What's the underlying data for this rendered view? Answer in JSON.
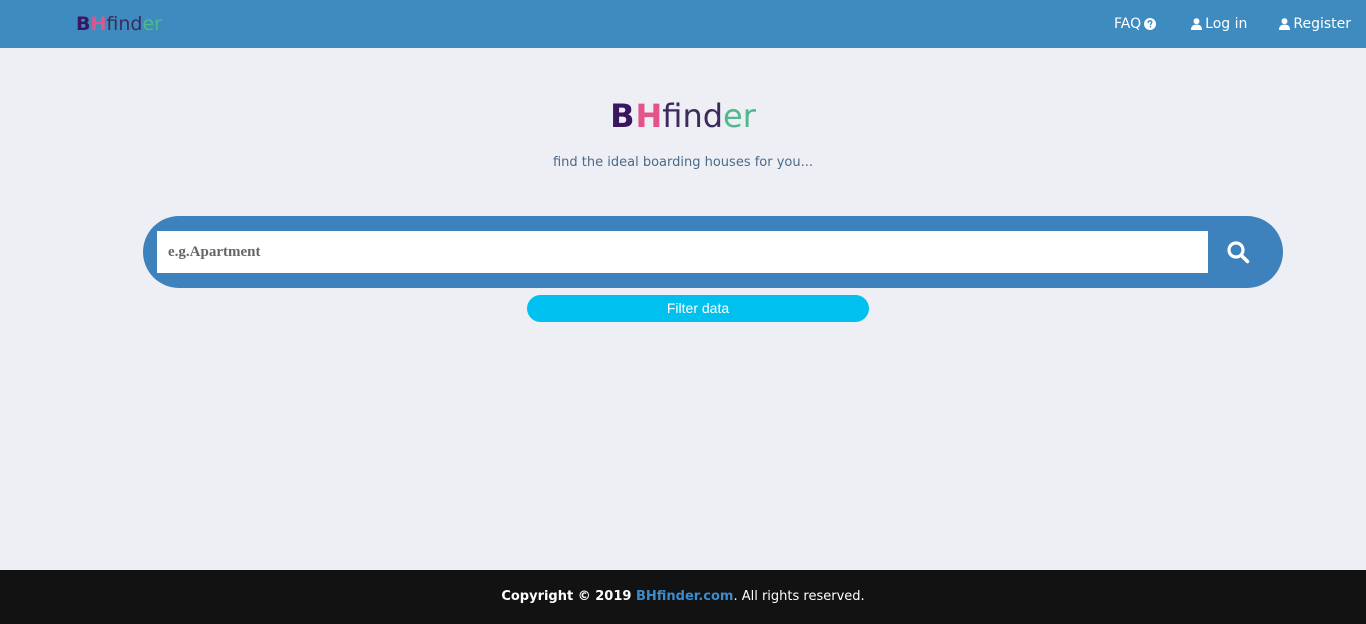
{
  "navbar": {
    "brand": {
      "b": "B",
      "h": "H",
      "fin": "find",
      "er": "er"
    },
    "links": [
      {
        "label": "FAQ",
        "icon": "question-circle-icon"
      },
      {
        "label": "Log in",
        "icon": "user-icon"
      },
      {
        "label": "Register",
        "icon": "user-icon"
      }
    ]
  },
  "hero": {
    "title": {
      "b": "B",
      "h": "H",
      "fin": "find",
      "er": "er"
    },
    "tagline": "find the ideal boarding houses for you..."
  },
  "search": {
    "placeholder": "e.g.Apartment",
    "value": "",
    "button_icon": "search-icon"
  },
  "filter": {
    "label": "Filter data"
  },
  "footer": {
    "prefix": "Copyright © 2019 ",
    "link": "BHfinder.com",
    "suffix": ". All rights reserved."
  },
  "colors": {
    "navbar": "#3d8bbf",
    "brand_b": "#3a1560",
    "brand_h": "#e3548a",
    "brand_er": "#4fb98a",
    "search_bar": "#3d82bd",
    "filter_button": "#00c0ef",
    "footer": "#121212"
  }
}
